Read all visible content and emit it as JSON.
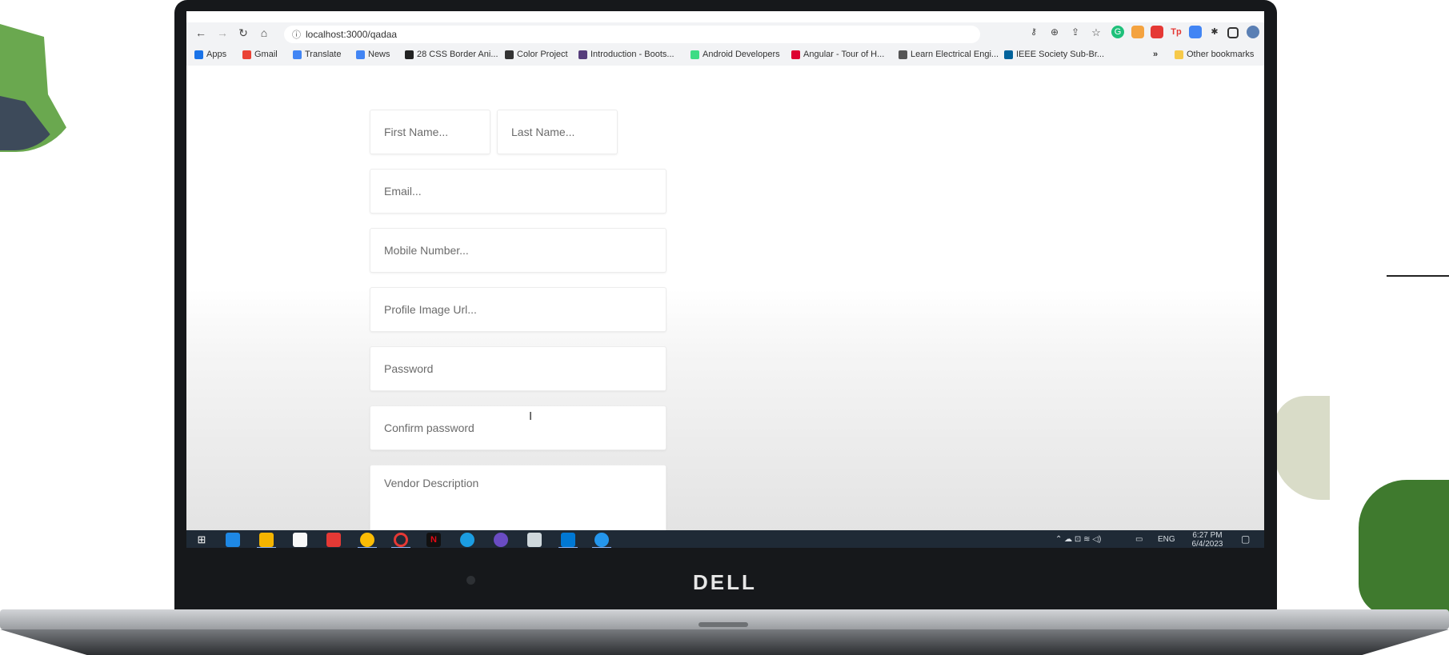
{
  "browser": {
    "url": "localhost:3000/qadaa",
    "bookmarks": [
      {
        "label": "Apps",
        "color": "#1a73e8"
      },
      {
        "label": "Gmail",
        "color": "#ea4335"
      },
      {
        "label": "Translate",
        "color": "#4285f4"
      },
      {
        "label": "News",
        "color": "#4285f4"
      },
      {
        "label": "28 CSS Border Ani...",
        "color": "#222222"
      },
      {
        "label": "Color Project",
        "color": "#333333"
      },
      {
        "label": "Introduction - Boots...",
        "color": "#563d7c"
      },
      {
        "label": "Android Developers",
        "color": "#3ddc84"
      },
      {
        "label": "Angular - Tour of H...",
        "color": "#dd0031"
      },
      {
        "label": "Learn Electrical Engi...",
        "color": "#555555"
      },
      {
        "label": "IEEE Society Sub-Br...",
        "color": "#00629b"
      }
    ],
    "overflow": "»",
    "other_bookmarks": "Other bookmarks"
  },
  "form": {
    "first_name_placeholder": "First Name...",
    "last_name_placeholder": "Last Name...",
    "email_placeholder": "Email...",
    "mobile_placeholder": "Mobile Number...",
    "profile_image_placeholder": "Profile Image Url...",
    "password_placeholder": "Password",
    "confirm_password_placeholder": "Confirm password",
    "description_placeholder": "Vendor Description"
  },
  "taskbar": {
    "language": "ENG",
    "time": "6:27 PM",
    "date": "6/4/2023"
  },
  "laptop": {
    "brand": "DELL"
  }
}
